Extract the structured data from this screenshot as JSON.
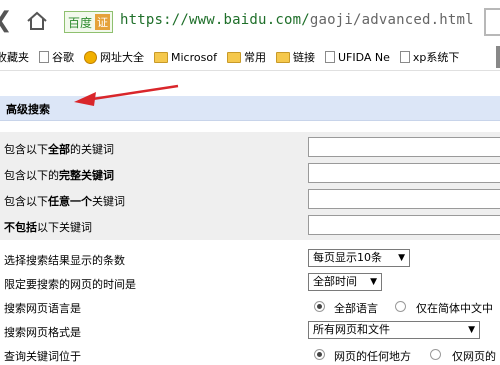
{
  "browser": {
    "badge_text": "百度",
    "badge_cert": "证",
    "url_host": "https://www.baidu.com/",
    "url_path": "gaoji/advanced.html"
  },
  "bookmarks": [
    {
      "label": "收藏夹",
      "icon": "folder-icon"
    },
    {
      "label": "谷歌",
      "icon": "page-icon"
    },
    {
      "label": "网址大全",
      "icon": "globe-icon"
    },
    {
      "label": "Microsof",
      "icon": "folder-icon"
    },
    {
      "label": "常用",
      "icon": "folder-icon"
    },
    {
      "label": "链接",
      "icon": "folder-icon"
    },
    {
      "label": "UFIDA Ne",
      "icon": "page-icon"
    },
    {
      "label": "xp系统下",
      "icon": "page-icon"
    }
  ],
  "form": {
    "title": "高级搜索",
    "kw_all_pre": "包含以下",
    "kw_all_bold": "全部",
    "kw_all_post": "的关键词",
    "kw_exact_pre": "包含以下的",
    "kw_exact_bold": "完整关键词",
    "kw_any_pre": "包含以下",
    "kw_any_bold": "任意一个",
    "kw_any_post": "关键词",
    "kw_none_bold": "不包括",
    "kw_none_post": "以下关键词",
    "results_label": "选择搜索结果显示的条数",
    "results_value": "每页显示10条",
    "time_label": "限定要搜索的网页的时间是",
    "time_value": "全部时间",
    "lang_label": "搜索网页语言是",
    "lang_opt1": "全部语言",
    "lang_opt2": "仅在简体中文中",
    "format_label": "搜索网页格式是",
    "format_value": "所有网页和文件",
    "position_label": "查询关键词位于",
    "position_opt1": "网页的任何地方",
    "position_opt2": "仅网页的"
  },
  "colors": {
    "title_bar": "#dce6f7",
    "arrow": "#d9262b",
    "url_green": "#1f6f2a"
  }
}
